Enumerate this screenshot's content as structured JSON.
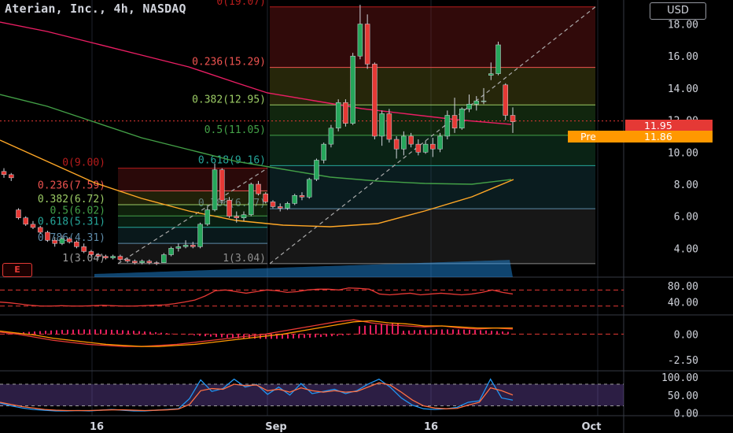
{
  "header": {
    "title": "Aterian, Inc., 4h, NASDAQ"
  },
  "currency_button": "USD",
  "price_tags": {
    "last": {
      "value": "11.95",
      "color": "#e53935"
    },
    "pre": {
      "label": "Pre",
      "value": "11.86",
      "color": "#ff9800"
    }
  },
  "earnings_badge": "E",
  "colors": {
    "up": "#26a65b",
    "down": "#e53935",
    "ma_short": "#e91e63",
    "ma_mid": "#43a047",
    "ma_long": "#ffa726"
  },
  "chart_data": [
    {
      "type": "candlestick",
      "title": "Aterian, Inc., 4h, NASDAQ",
      "x_tick_labels": [
        "16",
        "Sep",
        "16",
        "Oct"
      ],
      "y_tick_labels": [
        "18.00",
        "16.00",
        "14.00",
        "12.00",
        "10.00",
        "8.00",
        "6.00",
        "4.00"
      ],
      "ylim": [
        2.2,
        19.5
      ],
      "candles": [
        {
          "o": 8.8,
          "h": 9.0,
          "l": 8.4,
          "c": 8.6
        },
        {
          "o": 8.6,
          "h": 8.7,
          "l": 8.2,
          "c": 8.4
        },
        {
          "o": 6.4,
          "h": 6.5,
          "l": 5.8,
          "c": 5.9
        },
        {
          "o": 5.9,
          "h": 6.0,
          "l": 5.4,
          "c": 5.5
        },
        {
          "o": 5.5,
          "h": 5.7,
          "l": 5.2,
          "c": 5.3
        },
        {
          "o": 5.3,
          "h": 5.4,
          "l": 4.9,
          "c": 5.0
        },
        {
          "o": 5.0,
          "h": 5.1,
          "l": 4.4,
          "c": 4.5
        },
        {
          "o": 4.5,
          "h": 4.7,
          "l": 4.1,
          "c": 4.3
        },
        {
          "o": 4.3,
          "h": 4.8,
          "l": 4.2,
          "c": 4.6
        },
        {
          "o": 4.6,
          "h": 4.7,
          "l": 4.3,
          "c": 4.4
        },
        {
          "o": 4.4,
          "h": 4.5,
          "l": 4.0,
          "c": 4.1
        },
        {
          "o": 4.1,
          "h": 4.3,
          "l": 3.7,
          "c": 3.8
        },
        {
          "o": 3.8,
          "h": 3.9,
          "l": 3.5,
          "c": 3.6
        },
        {
          "o": 3.6,
          "h": 3.7,
          "l": 3.4,
          "c": 3.5
        },
        {
          "o": 3.5,
          "h": 3.6,
          "l": 3.3,
          "c": 3.4
        },
        {
          "o": 3.4,
          "h": 3.6,
          "l": 3.3,
          "c": 3.5
        },
        {
          "o": 3.5,
          "h": 3.6,
          "l": 3.2,
          "c": 3.3
        },
        {
          "o": 3.3,
          "h": 3.4,
          "l": 3.1,
          "c": 3.2
        },
        {
          "o": 3.2,
          "h": 3.3,
          "l": 3.0,
          "c": 3.1
        },
        {
          "o": 3.1,
          "h": 3.3,
          "l": 3.0,
          "c": 3.2
        },
        {
          "o": 3.2,
          "h": 3.3,
          "l": 3.0,
          "c": 3.1
        },
        {
          "o": 3.1,
          "h": 3.2,
          "l": 2.95,
          "c": 3.05
        },
        {
          "o": 3.1,
          "h": 3.7,
          "l": 3.1,
          "c": 3.6
        },
        {
          "o": 3.6,
          "h": 4.1,
          "l": 3.5,
          "c": 4.0
        },
        {
          "o": 4.0,
          "h": 4.3,
          "l": 3.8,
          "c": 4.1
        },
        {
          "o": 4.1,
          "h": 4.5,
          "l": 4.0,
          "c": 4.2
        },
        {
          "o": 4.2,
          "h": 4.4,
          "l": 4.0,
          "c": 4.1
        },
        {
          "o": 4.1,
          "h": 5.6,
          "l": 4.0,
          "c": 5.5
        },
        {
          "o": 5.5,
          "h": 6.6,
          "l": 5.4,
          "c": 6.4
        },
        {
          "o": 6.4,
          "h": 9.3,
          "l": 6.3,
          "c": 8.9
        },
        {
          "o": 8.9,
          "h": 9.0,
          "l": 6.8,
          "c": 7.0
        },
        {
          "o": 7.0,
          "h": 7.2,
          "l": 5.9,
          "c": 6.0
        },
        {
          "o": 6.0,
          "h": 6.3,
          "l": 5.6,
          "c": 5.9
        },
        {
          "o": 5.9,
          "h": 6.3,
          "l": 5.7,
          "c": 6.1
        },
        {
          "o": 6.1,
          "h": 8.1,
          "l": 6.0,
          "c": 8.0
        },
        {
          "o": 8.0,
          "h": 8.2,
          "l": 7.3,
          "c": 7.4
        },
        {
          "o": 7.4,
          "h": 7.5,
          "l": 6.8,
          "c": 6.9
        },
        {
          "o": 6.9,
          "h": 7.0,
          "l": 6.5,
          "c": 6.6
        },
        {
          "o": 6.6,
          "h": 6.8,
          "l": 6.3,
          "c": 6.5
        },
        {
          "o": 6.5,
          "h": 6.9,
          "l": 6.4,
          "c": 6.8
        },
        {
          "o": 6.8,
          "h": 7.4,
          "l": 6.7,
          "c": 7.3
        },
        {
          "o": 7.3,
          "h": 7.5,
          "l": 7.0,
          "c": 7.2
        },
        {
          "o": 7.2,
          "h": 8.4,
          "l": 7.1,
          "c": 8.3
        },
        {
          "o": 8.3,
          "h": 9.6,
          "l": 8.2,
          "c": 9.5
        },
        {
          "o": 9.5,
          "h": 10.6,
          "l": 9.3,
          "c": 10.5
        },
        {
          "o": 10.5,
          "h": 11.7,
          "l": 10.3,
          "c": 11.5
        },
        {
          "o": 11.5,
          "h": 13.3,
          "l": 11.3,
          "c": 13.1
        },
        {
          "o": 13.1,
          "h": 13.3,
          "l": 11.6,
          "c": 11.8
        },
        {
          "o": 11.8,
          "h": 16.2,
          "l": 11.7,
          "c": 16.0
        },
        {
          "o": 16.0,
          "h": 19.2,
          "l": 15.8,
          "c": 18.0
        },
        {
          "o": 18.0,
          "h": 18.6,
          "l": 15.2,
          "c": 15.5
        },
        {
          "o": 15.5,
          "h": 15.6,
          "l": 10.8,
          "c": 11.0
        },
        {
          "o": 11.0,
          "h": 12.6,
          "l": 10.4,
          "c": 12.4
        },
        {
          "o": 12.4,
          "h": 12.7,
          "l": 10.6,
          "c": 10.8
        },
        {
          "o": 10.8,
          "h": 11.0,
          "l": 9.6,
          "c": 10.2
        },
        {
          "o": 10.2,
          "h": 11.3,
          "l": 9.8,
          "c": 11.0
        },
        {
          "o": 11.0,
          "h": 11.2,
          "l": 10.3,
          "c": 10.5
        },
        {
          "o": 10.5,
          "h": 10.8,
          "l": 9.8,
          "c": 10.0
        },
        {
          "o": 10.0,
          "h": 10.7,
          "l": 9.9,
          "c": 10.5
        },
        {
          "o": 10.5,
          "h": 10.9,
          "l": 9.7,
          "c": 10.2
        },
        {
          "o": 10.2,
          "h": 11.2,
          "l": 10.0,
          "c": 11.0
        },
        {
          "o": 11.0,
          "h": 12.6,
          "l": 10.8,
          "c": 12.3
        },
        {
          "o": 12.3,
          "h": 13.4,
          "l": 11.2,
          "c": 11.5
        },
        {
          "o": 11.5,
          "h": 12.8,
          "l": 11.4,
          "c": 12.7
        },
        {
          "o": 12.7,
          "h": 13.6,
          "l": 12.5,
          "c": 13.0
        },
        {
          "o": 13.0,
          "h": 13.5,
          "l": 12.6,
          "c": 13.2
        },
        {
          "o": 13.2,
          "h": 14.0,
          "l": 13.0,
          "c": 13.2
        },
        {
          "o": 14.8,
          "h": 15.6,
          "l": 14.5,
          "c": 14.9
        },
        {
          "o": 14.9,
          "h": 16.9,
          "l": 14.8,
          "c": 16.7
        },
        {
          "o": 14.2,
          "h": 14.3,
          "l": 12.0,
          "c": 12.3
        },
        {
          "o": 12.3,
          "h": 12.8,
          "l": 11.2,
          "c": 11.9
        }
      ],
      "fib_right": {
        "levels": [
          {
            "label": "0(19.07)",
            "value": 19.07
          },
          {
            "label": "0.236(15.29)",
            "value": 15.29
          },
          {
            "label": "0.382(12.95)",
            "value": 12.95
          },
          {
            "label": "0.5(11.05)",
            "value": 11.05
          },
          {
            "label": "0.618(9.16)",
            "value": 9.16
          },
          {
            "label": "0.786(6.47)",
            "value": 6.47
          },
          {
            "label": "1(3.04)",
            "value": 3.04
          }
        ]
      },
      "fib_left": {
        "levels": [
          {
            "label": "0(9.00)",
            "value": 9.0
          },
          {
            "label": "0.236(7.59)",
            "value": 7.59
          },
          {
            "label": "0.382(6.72)",
            "value": 6.72
          },
          {
            "label": "0.5(6.02)",
            "value": 6.02
          },
          {
            "label": "0.618(5.31)",
            "value": 5.31
          },
          {
            "label": "0.786(4.31)",
            "value": 4.31
          },
          {
            "label": "1(3.04)",
            "value": 3.04
          }
        ]
      }
    },
    {
      "type": "line",
      "y_tick_labels": [
        "80.00",
        "40.00"
      ],
      "ylim": [
        10,
        100
      ],
      "series": [
        {
          "values": [
            40,
            38,
            35,
            32,
            30,
            30,
            31,
            30,
            30,
            31,
            32,
            31,
            30,
            30,
            31,
            32,
            33,
            36,
            40,
            45,
            55,
            68,
            70,
            66,
            62,
            66,
            70,
            68,
            64,
            66,
            70,
            72,
            72,
            70,
            75,
            74,
            72,
            60,
            58,
            60,
            62,
            58,
            60,
            62,
            60,
            58,
            60,
            64,
            70,
            64,
            60
          ]
        }
      ]
    },
    {
      "type": "line",
      "y_tick_labels": [
        "0.00",
        "-2.50"
      ],
      "ylim": [
        -3.5,
        1.8
      ],
      "series": [
        {
          "values": [
            0.2,
            0.0,
            -0.3,
            -0.6,
            -0.8,
            -1.0,
            -1.1,
            -1.2,
            -1.2,
            -1.1,
            -1.0,
            -0.8,
            -0.6,
            -0.4,
            -0.2,
            0.0,
            0.3,
            0.6,
            0.9,
            1.2,
            1.4,
            1.1,
            0.9,
            0.8,
            0.7,
            0.8,
            0.6,
            0.5,
            0.6,
            0.5
          ]
        },
        {
          "values": [
            0.3,
            0.1,
            -0.1,
            -0.4,
            -0.6,
            -0.8,
            -1.0,
            -1.1,
            -1.2,
            -1.2,
            -1.1,
            -1.0,
            -0.8,
            -0.6,
            -0.4,
            -0.2,
            0.0,
            0.3,
            0.6,
            0.9,
            1.2,
            1.3,
            1.1,
            1.0,
            0.8,
            0.8,
            0.7,
            0.6,
            0.6,
            0.6
          ]
        }
      ]
    },
    {
      "type": "line",
      "y_tick_labels": [
        "100.00",
        "50.00",
        "0.00"
      ],
      "ylim": [
        -5,
        115
      ],
      "series": [
        {
          "values": [
            28,
            20,
            14,
            10,
            8,
            6,
            6,
            7,
            6,
            8,
            10,
            8,
            6,
            6,
            8,
            10,
            12,
            40,
            92,
            60,
            68,
            94,
            72,
            80,
            52,
            72,
            50,
            82,
            54,
            60,
            66,
            54,
            62,
            80,
            94,
            72,
            42,
            22,
            12,
            10,
            12,
            16,
            30,
            34,
            94,
            42,
            36
          ]
        },
        {
          "values": [
            30,
            24,
            18,
            14,
            10,
            8,
            7,
            7,
            7,
            8,
            9,
            9,
            8,
            7,
            8,
            9,
            11,
            24,
            62,
            68,
            66,
            80,
            76,
            78,
            62,
            66,
            58,
            70,
            62,
            58,
            62,
            58,
            60,
            72,
            84,
            78,
            58,
            36,
            20,
            14,
            12,
            13,
            22,
            30,
            70,
            62,
            50
          ]
        }
      ]
    }
  ]
}
